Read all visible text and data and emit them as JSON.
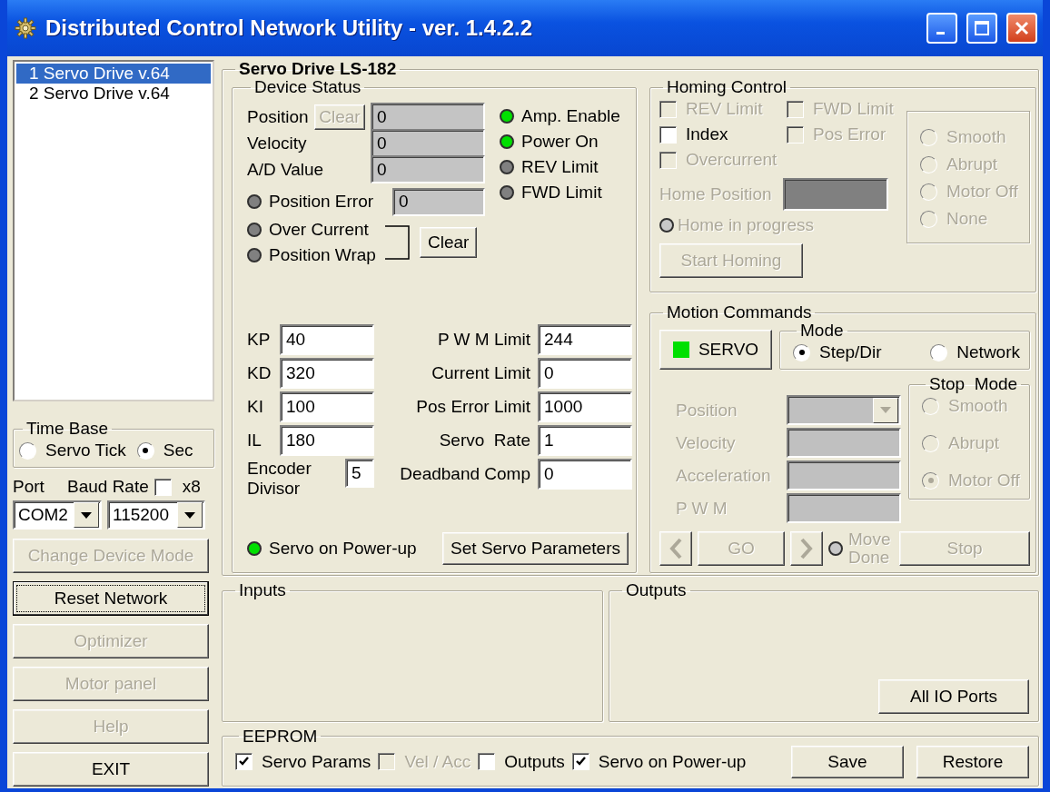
{
  "window": {
    "title": "Distributed Control Network Utility - ver. 1.4.2.2"
  },
  "devices": [
    {
      "label": "1 Servo Drive v.64",
      "selected": true
    },
    {
      "label": "2 Servo Drive v.64",
      "selected": false
    }
  ],
  "time_base": {
    "title": "Time Base",
    "options": [
      {
        "label": "Servo Tick",
        "selected": false
      },
      {
        "label": "Sec",
        "selected": true
      }
    ]
  },
  "port": {
    "label": "Port",
    "value": "COM2"
  },
  "baud": {
    "label": "Baud Rate",
    "x8_label": "x8",
    "x8_checked": false,
    "value": "115200"
  },
  "side_buttons": [
    {
      "label": "Change Device Mode",
      "disabled": true,
      "focused": false
    },
    {
      "label": "Reset Network",
      "disabled": false,
      "focused": true
    },
    {
      "label": "Optimizer",
      "disabled": true,
      "focused": false
    },
    {
      "label": "Motor panel",
      "disabled": true,
      "focused": false
    },
    {
      "label": "Help",
      "disabled": true,
      "focused": false
    },
    {
      "label": "EXIT",
      "disabled": false,
      "focused": false
    }
  ],
  "drive": {
    "title": "Servo Drive LS-182"
  },
  "device_status": {
    "title": "Device Status",
    "position_clear": {
      "label": "Clear",
      "disabled": true
    },
    "readouts": [
      {
        "label": "Position",
        "value": "0"
      },
      {
        "label": "Velocity",
        "value": "0"
      },
      {
        "label": "A/D Value",
        "value": "0"
      }
    ],
    "indicators": [
      {
        "label": "Amp. Enable",
        "on": true
      },
      {
        "label": "Power On",
        "on": true
      },
      {
        "label": "REV Limit",
        "on": false
      },
      {
        "label": "FWD Limit",
        "on": false
      }
    ],
    "errors": [
      {
        "label": "Position Error",
        "on": false,
        "value": "0"
      },
      {
        "label": "Over Current",
        "on": false
      },
      {
        "label": "Position Wrap",
        "on": false
      }
    ],
    "clear_button": "Clear",
    "params_left": [
      {
        "label": "KP",
        "value": "40"
      },
      {
        "label": "KD",
        "value": "320"
      },
      {
        "label": "KI",
        "value": "100"
      },
      {
        "label": "IL",
        "value": "180"
      }
    ],
    "encoder": {
      "label": "Encoder Divisor",
      "value": "5"
    },
    "params_right": [
      {
        "label": "P W M Limit",
        "value": "244"
      },
      {
        "label": "Current Limit",
        "value": "0"
      },
      {
        "label": "Pos Error Limit",
        "value": "1000"
      },
      {
        "label": "Servo  Rate",
        "value": "1"
      },
      {
        "label": "Deadband Comp",
        "value": "0"
      }
    ],
    "servo_on_powerup": {
      "label": "Servo on Power-up",
      "on": true
    },
    "set_button": "Set Servo Parameters"
  },
  "homing": {
    "title": "Homing Control",
    "checks": [
      {
        "label": "REV Limit",
        "checked": false,
        "disabled": true
      },
      {
        "label": "FWD Limit",
        "checked": false,
        "disabled": true
      },
      {
        "label": "Index",
        "checked": false,
        "disabled": false
      },
      {
        "label": "Pos Error",
        "checked": false,
        "disabled": true
      },
      {
        "label": "Overcurrent",
        "checked": false,
        "disabled": true
      }
    ],
    "home_position": {
      "label": "Home Position"
    },
    "home_in_progress": {
      "label": "Home in progress",
      "on": false
    },
    "start_button": {
      "label": "Start Homing",
      "disabled": true
    },
    "stop_options": [
      {
        "label": "Smooth",
        "selected": false,
        "disabled": true
      },
      {
        "label": "Abrupt",
        "selected": false,
        "disabled": true
      },
      {
        "label": "Motor Off",
        "selected": false,
        "disabled": true
      },
      {
        "label": "None",
        "selected": false,
        "disabled": true
      }
    ]
  },
  "motion": {
    "title": "Motion Commands",
    "servo_button": {
      "label": "SERVO",
      "on": true
    },
    "mode": {
      "title": "Mode",
      "options": [
        {
          "label": "Step/Dir",
          "selected": true
        },
        {
          "label": "Network",
          "selected": false
        }
      ]
    },
    "fields": [
      {
        "label": "Position",
        "kind": "dropdown"
      },
      {
        "label": "Velocity",
        "kind": "text"
      },
      {
        "label": "Acceleration",
        "kind": "text"
      },
      {
        "label": "P W M",
        "kind": "text"
      }
    ],
    "stop_mode": {
      "title": "Stop  Mode",
      "options": [
        {
          "label": "Smooth",
          "selected": false,
          "disabled": true
        },
        {
          "label": "Abrupt",
          "selected": false,
          "disabled": true
        },
        {
          "label": "Motor Off",
          "selected": true,
          "disabled": true
        }
      ]
    },
    "go_button": "GO",
    "move_done": {
      "label": "Move Done",
      "on": false
    },
    "stop_button": "Stop"
  },
  "inputs": {
    "title": "Inputs"
  },
  "outputs": {
    "title": "Outputs",
    "button": "All IO Ports"
  },
  "eeprom": {
    "title": "EEPROM",
    "checks": [
      {
        "label": "Servo Params",
        "checked": true,
        "disabled": false
      },
      {
        "label": "Vel / Acc",
        "checked": false,
        "disabled": true
      },
      {
        "label": "Outputs",
        "checked": false,
        "disabled": false
      },
      {
        "label": "Servo on Power-up",
        "checked": true,
        "disabled": false
      }
    ],
    "buttons": [
      "Save",
      "Restore"
    ]
  }
}
